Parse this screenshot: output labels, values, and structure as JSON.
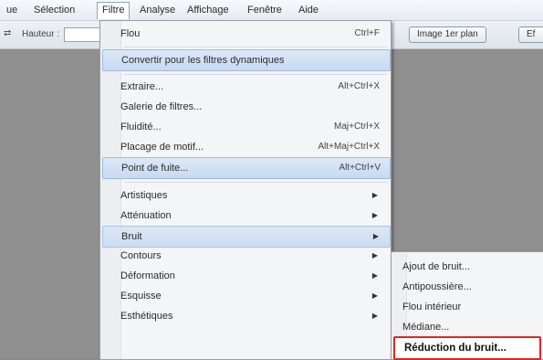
{
  "menubar": {
    "items": [
      "ue",
      "Sélection",
      "Filtre",
      "Analyse",
      "Affichage",
      "Fenêtre",
      "Aide"
    ]
  },
  "options_bar": {
    "height_label": "Hauteur :",
    "front_image_button": "Image 1er plan",
    "partial_button": "Ef"
  },
  "filter_menu": {
    "items": [
      {
        "label": "Flou",
        "shortcut": "Ctrl+F"
      },
      {
        "label": "Convertir pour les filtres dynamiques",
        "shortcut": ""
      },
      {
        "label": "Extraire...",
        "shortcut": "Alt+Ctrl+X"
      },
      {
        "label": "Galerie de filtres...",
        "shortcut": ""
      },
      {
        "label": "Fluidité...",
        "shortcut": "Maj+Ctrl+X"
      },
      {
        "label": "Placage de motif...",
        "shortcut": "Alt+Maj+Ctrl+X"
      },
      {
        "label": "Point de fuite...",
        "shortcut": "Alt+Ctrl+V"
      },
      {
        "label": "Artistiques",
        "shortcut": ""
      },
      {
        "label": "Atténuation",
        "shortcut": ""
      },
      {
        "label": "Bruit",
        "shortcut": ""
      },
      {
        "label": "Contours",
        "shortcut": ""
      },
      {
        "label": "Déformation",
        "shortcut": ""
      },
      {
        "label": "Esquisse",
        "shortcut": ""
      },
      {
        "label": "Esthétiques",
        "shortcut": ""
      }
    ]
  },
  "noise_submenu": {
    "items": [
      "Ajout de bruit...",
      "Antipoussière...",
      "Flou intérieur",
      "Médiane...",
      "Réduction du bruit..."
    ]
  },
  "colors": {
    "highlight": "#c7daf2",
    "target_outline": "#e0271f"
  }
}
